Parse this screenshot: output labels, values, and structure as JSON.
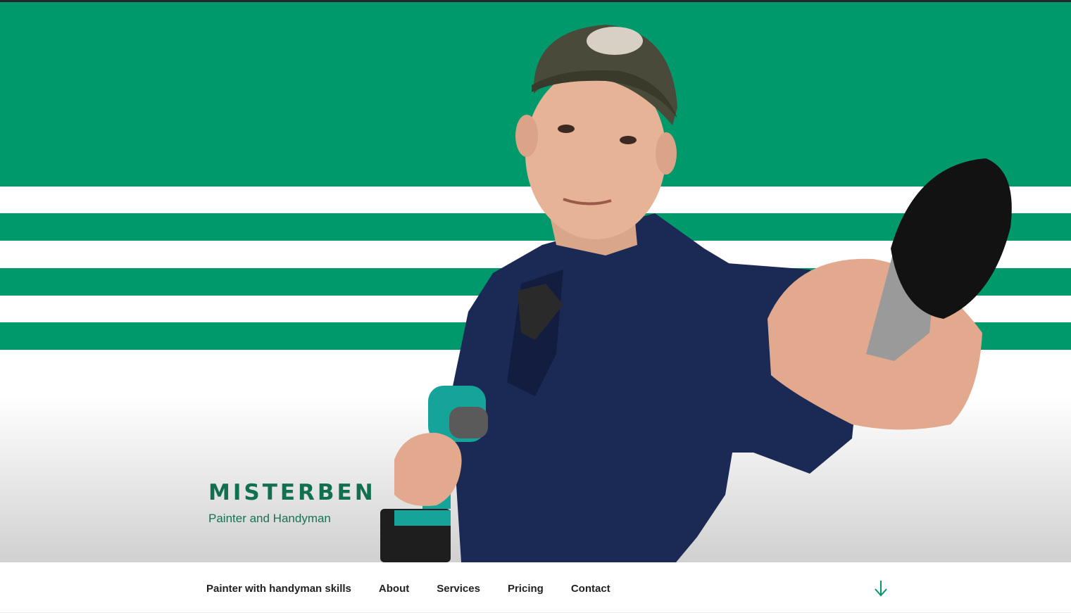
{
  "site": {
    "title": "MISTERBEN",
    "tagline": "Painter and Handyman"
  },
  "nav": {
    "items": [
      {
        "label": "Painter with handyman skills"
      },
      {
        "label": "About"
      },
      {
        "label": "Services"
      },
      {
        "label": "Pricing"
      },
      {
        "label": "Contact"
      }
    ],
    "scroll_icon": "arrow-down-icon"
  },
  "colors": {
    "brand_green": "#00996b",
    "title_green": "#11704f",
    "shirt_navy": "#1b2a55",
    "cap_olive": "#4a4a3a",
    "drill_teal": "#16a39a"
  }
}
